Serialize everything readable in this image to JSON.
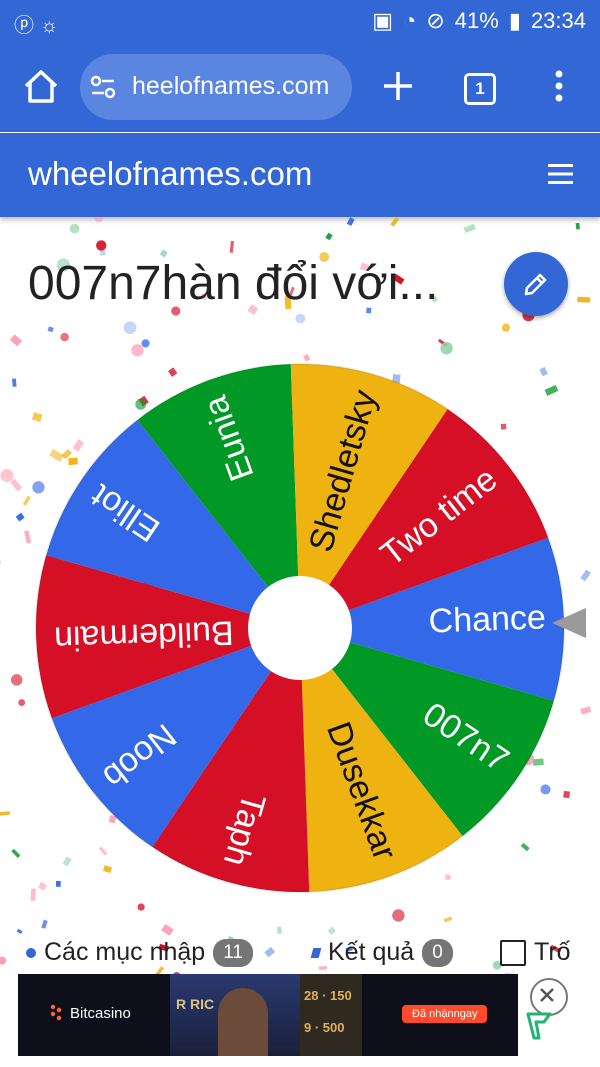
{
  "status_bar": {
    "battery_percent": "41%",
    "time": "23:34"
  },
  "browser": {
    "url": "heelofnames.com",
    "tab_count": "1"
  },
  "site": {
    "brand": "wheelofnames.com"
  },
  "wheel": {
    "title": "007n7hàn đổi với...",
    "segments": [
      {
        "label": "Chance",
        "color": "#3369e8"
      },
      {
        "label": "007n7",
        "color": "#009925"
      },
      {
        "label": "Dusekkar",
        "color": "#eeb211"
      },
      {
        "label": "Taph",
        "color": "#d50f25"
      },
      {
        "label": "Noob",
        "color": "#3369e8"
      },
      {
        "label": "Buildermain",
        "color": "#d50f25"
      },
      {
        "label": "Elliot",
        "color": "#3369e8"
      },
      {
        "label": "Eunia",
        "color": "#009925"
      },
      {
        "label": "Shedletsky",
        "color": "#eeb211"
      },
      {
        "label": "Two time",
        "color": "#d50f25"
      }
    ]
  },
  "tabs": {
    "entries_label": "Các mục nhập",
    "entries_count": "11",
    "results_label": "Kết quả",
    "results_count": "0",
    "third_label": "Trố"
  },
  "ad": {
    "brand": "Bitcasino",
    "photo_text": "R RIC",
    "chip_1": "28 · 150",
    "chip_2": "9 · 500",
    "cta": "Đã nhậnngay"
  },
  "colors": {
    "header_blue": "#3367d6",
    "accent_gray": "#757575"
  }
}
